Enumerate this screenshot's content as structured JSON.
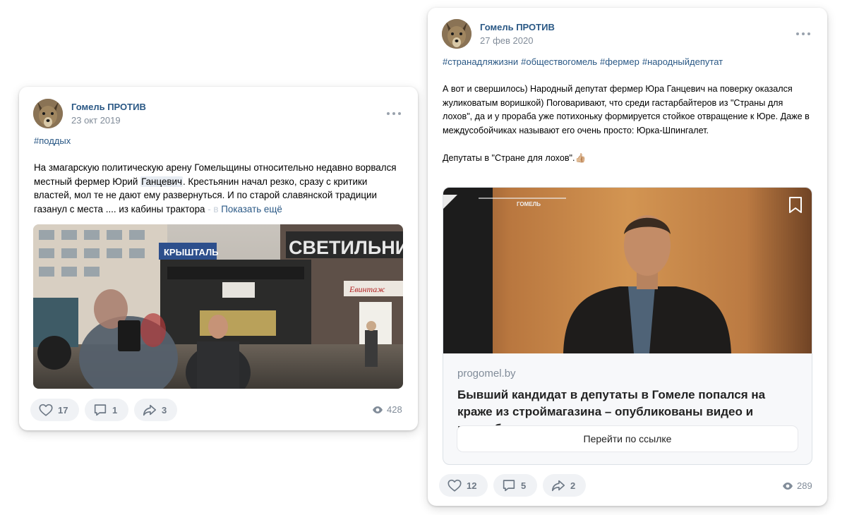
{
  "posts": [
    {
      "author": "Гомель ПРОТИВ",
      "date": "23 окт 2019",
      "tags": [
        "#поддых"
      ],
      "text_before_hl": "На змагарскую политическую арену Гомельщины относительно недавно ворвался местный фермер Юрий ",
      "text_hl": "Ганцевич",
      "text_after_hl": ". Крестьянин начал резко, сразу с критики властей, мол те не дают ему развернуться. И по старой славянской традиции газанул с места .... из кабины трактора",
      "text_fade": " - в",
      "show_more": "Показать ещё",
      "photo_signs": {
        "store": "СВЕТИЛЬНИ",
        "shop": "КРЫШТАЛЬ",
        "small_sign": "Евинтаж"
      },
      "likes": "17",
      "comments": "1",
      "shares": "3",
      "views": "428"
    },
    {
      "author": "Гомель ПРОТИВ",
      "date": "27 фев 2020",
      "tags": [
        "#странадляжизни",
        "#обществогомель",
        "#фермер",
        "#народныйдепутат"
      ],
      "paragraph1": "А вот и свершилось) Народный депутат фермер Юра Ганцевич на поверку оказался жуликоватым воришкой) Поговаривают, что среди гастарбайтеров из \"Страны для лохов\", да и у прораба уже потихоньку формируется стойкое отвращение к Юре. Даже в междусобойчиках называют его очень просто: Юрка-Шпингалет.",
      "paragraph2": "Депутаты в \"Стране для лохов\".",
      "emoji": "👍🏼",
      "photo_watermark": "ГОМЕЛЬ",
      "snippet": {
        "domain": "progomel.by",
        "title": "Бывший кандидат в депутаты в Гомеле попался на краже из строймагазина – опубликованы видео и подробн",
        "button": "Перейти по ссылке"
      },
      "likes": "12",
      "comments": "5",
      "shares": "2",
      "views": "289"
    }
  ]
}
